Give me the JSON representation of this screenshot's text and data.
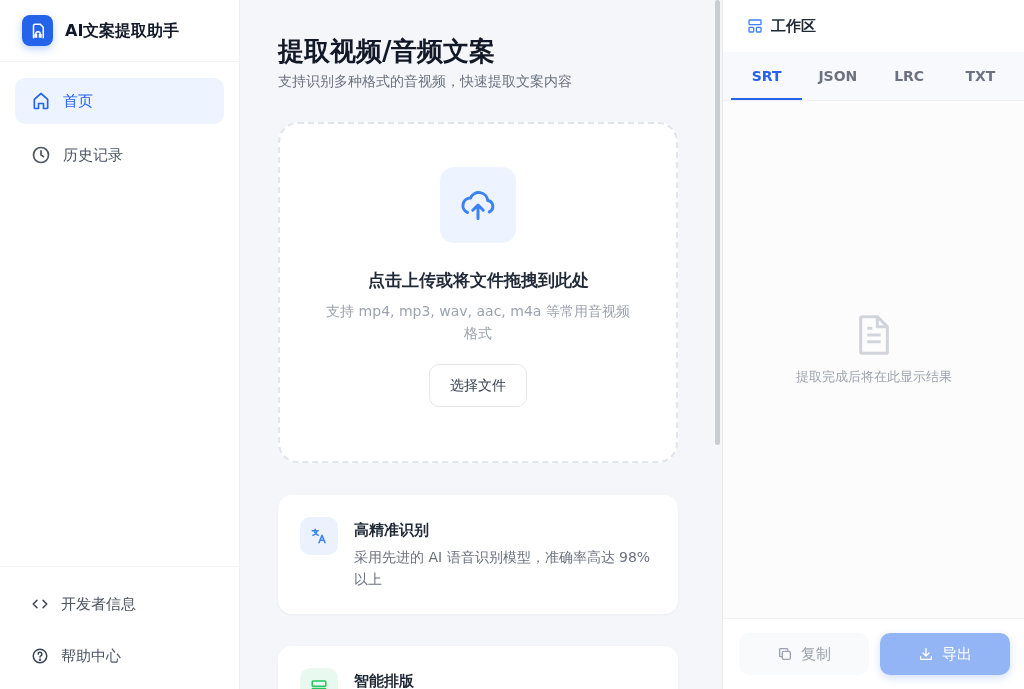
{
  "app": {
    "title": "AI文案提取助手"
  },
  "sidebar": {
    "items": [
      {
        "kind": "home",
        "label": "首页",
        "selected": true
      },
      {
        "kind": "history",
        "label": "历史记录",
        "selected": false
      }
    ],
    "footer_items": [
      {
        "kind": "code",
        "label": "开发者信息"
      },
      {
        "kind": "help",
        "label": "帮助中心"
      }
    ]
  },
  "main": {
    "title": "提取视频/音频文案",
    "subtitle": "支持识别多种格式的音视频，快速提取文案内容",
    "upload": {
      "title": "点击上传或将文件拖拽到此处",
      "hint": "支持 mp4, mp3, wav, aac, m4a 等常用音视频格式",
      "button": "选择文件"
    },
    "features": [
      {
        "kind": "translate",
        "color": "#3b82f6",
        "title": "高精准识别",
        "description": "采用先进的 AI 语音识别模型，准确率高达 98% 以上"
      },
      {
        "kind": "layout",
        "color": "#22c55e",
        "title": "智能排版"
      }
    ]
  },
  "workspace": {
    "title": "工作区",
    "tabs": [
      {
        "label": "SRT",
        "selected": true
      },
      {
        "label": "JSON",
        "selected": false
      },
      {
        "label": "LRC",
        "selected": false
      },
      {
        "label": "TXT",
        "selected": false
      }
    ],
    "empty_text": "提取完成后将在此显示结果",
    "buttons": [
      {
        "kind": "copy",
        "label": "复制",
        "disabled": true
      },
      {
        "kind": "export",
        "label": "导出",
        "disabled": true
      }
    ]
  }
}
